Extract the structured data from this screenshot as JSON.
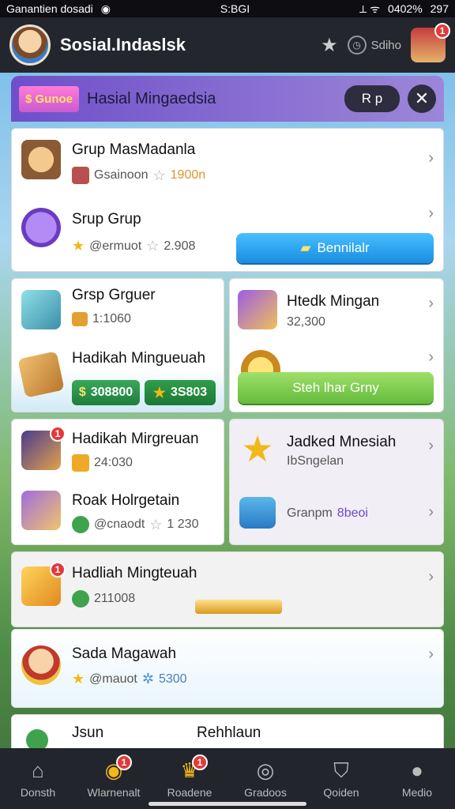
{
  "status": {
    "left": "Ganantien dosadi",
    "center": "S:BGI",
    "right": "0402%",
    "time": "297"
  },
  "app": {
    "title": "Sosial.Indaslsk",
    "pill_text": "Sdiho"
  },
  "banner": {
    "tag": "Gunoe",
    "title": "Hasial Mingaedsia",
    "rp_label": "R p",
    "close": "✕"
  },
  "cards": {
    "c1": {
      "r1": {
        "title": "Grup MasMadanla",
        "sub": "Gsainoon",
        "value": "1900n"
      },
      "r2": {
        "title": "Srup Grup",
        "sub": "@ermuot",
        "value": "2.908",
        "button": "Bennilalr"
      }
    },
    "c2": {
      "r1": {
        "title": "Grsp Grguer",
        "value": "1:1060"
      },
      "r2": {
        "title": "Hadikah Mingueuah",
        "chip1": "308800",
        "chip2": "3S803"
      }
    },
    "c3": {
      "r1": {
        "title": "Htedk Mingan",
        "value": "32,300"
      },
      "r2": {
        "button": "Steh lhar Grny"
      }
    },
    "c4": {
      "r1": {
        "title": "Hadikah Mirgreuan",
        "value": "24:030"
      },
      "r2": {
        "title": "Roak Holrgetain",
        "sub": "@cnaodt",
        "value": "1 230"
      }
    },
    "c5": {
      "r1": {
        "title": "Jadked Mnesiah",
        "sub": "IbSngelan"
      },
      "r2": {
        "sub": "Granpm",
        "value": "8beoi"
      }
    },
    "c6": {
      "title": "Hadliah Mingteuah",
      "value": "211008"
    },
    "c7": {
      "title": "Sada Magawah",
      "sub": "@mauot",
      "value": "5300"
    },
    "c8": {
      "left": "Jsun",
      "right": "Rehhlaun"
    }
  },
  "nav": [
    {
      "label": "Donsth",
      "icon": "home-icon",
      "badge": ""
    },
    {
      "label": "Wlarnenalt",
      "icon": "coins-icon",
      "badge": "1"
    },
    {
      "label": "Roadene",
      "icon": "crown-icon",
      "badge": "1"
    },
    {
      "label": "Gradoos",
      "icon": "compass-icon",
      "badge": ""
    },
    {
      "label": "Qoiden",
      "icon": "shield-icon",
      "badge": ""
    },
    {
      "label": "Medio",
      "icon": "person-icon",
      "badge": ""
    }
  ],
  "colors": {
    "accent_blue": "#1a8de0",
    "accent_green": "#64bb3c",
    "banner_purple": "#6f4fc9"
  }
}
